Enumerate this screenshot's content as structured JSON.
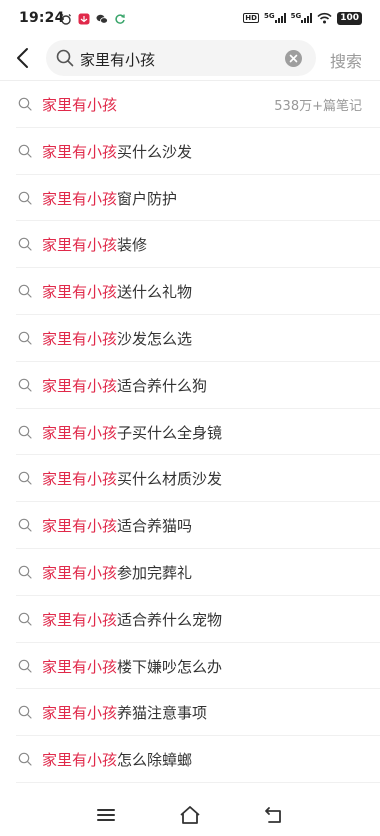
{
  "status_bar": {
    "time": "19:24",
    "network1": "5G",
    "network2": "5G",
    "hd": "HD",
    "battery": "100"
  },
  "search": {
    "query": "家里有小孩",
    "submit_label": "搜索"
  },
  "suggestions": [
    {
      "highlight": "家里有小孩",
      "rest": "",
      "count": "538万+篇笔记"
    },
    {
      "highlight": "家里有小孩",
      "rest": "买什么沙发"
    },
    {
      "highlight": "家里有小孩",
      "rest": "窗户防护"
    },
    {
      "highlight": "家里有小孩",
      "rest": "装修"
    },
    {
      "highlight": "家里有小孩",
      "rest": "送什么礼物"
    },
    {
      "highlight": "家里有小孩",
      "rest": "沙发怎么选"
    },
    {
      "highlight": "家里有小孩",
      "rest": "适合养什么狗"
    },
    {
      "highlight": "家里有小孩",
      "rest": "子买什么全身镜"
    },
    {
      "highlight": "家里有小孩",
      "rest": "买什么材质沙发"
    },
    {
      "highlight": "家里有小孩",
      "rest": "适合养猫吗"
    },
    {
      "highlight": "家里有小孩",
      "rest": "参加完葬礼"
    },
    {
      "highlight": "家里有小孩",
      "rest": "适合养什么宠物"
    },
    {
      "highlight": "家里有小孩",
      "rest": "楼下嫌吵怎么办"
    },
    {
      "highlight": "家里有小孩",
      "rest": "养猫注意事项"
    },
    {
      "highlight": "家里有小孩",
      "rest": "怎么除蟑螂"
    }
  ],
  "colors": {
    "highlight": "#e0294a",
    "muted": "#999999"
  },
  "icons": [
    "back-arrow-icon",
    "search-icon",
    "clear-icon",
    "menu-icon",
    "home-icon",
    "return-icon"
  ]
}
